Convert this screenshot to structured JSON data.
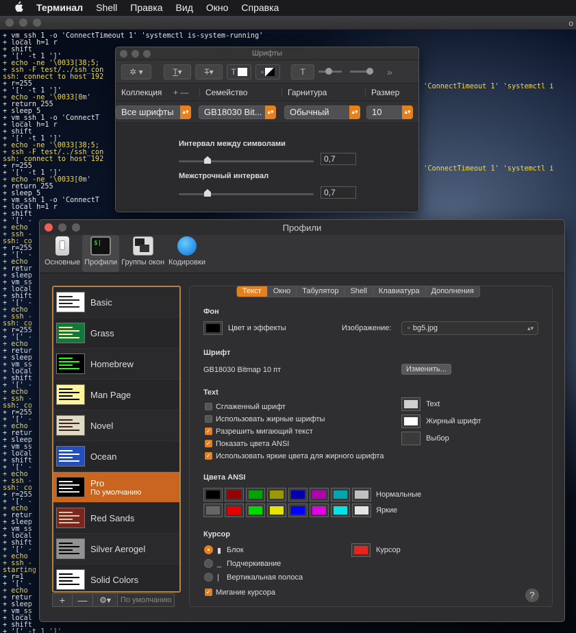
{
  "menubar": {
    "apple": "",
    "app": "Терминал",
    "items": [
      "Shell",
      "Правка",
      "Вид",
      "Окно",
      "Справка"
    ]
  },
  "terminal": {
    "title_fragment": "o",
    "lines": [
      "+ vm_ssh 1 -o 'ConnectTimeout 1' 'systemctl is-system-running'",
      "+ local h=1 r",
      "+ shift",
      "+ '[' -t 1 ']'",
      "+ echo -ne '\\0033[38;5;",
      "+ ssh -F test/../ssh_con",
      "ssh: connect to host 192",
      "+ r=255",
      "+ '[' -t 1 ']'",
      "+ echo -ne '\\0033[0m'",
      "+ return 255",
      "+ sleep 5",
      "+ vm_ssh 1 -o 'ConnectT",
      "+ local h=1 r",
      "+ shift",
      "+ '[' -t 1 ']'",
      "+ echo -ne '\\0033[38;5;",
      "+ ssh -F test/../ssh_con",
      "ssh: connect to host 192",
      "+ r=255",
      "+ '[' -t 1 ']'",
      "+ echo -ne '\\0033[0m'",
      "+ return 255",
      "+ sleep 5",
      "+ vm_ssh 1 -o 'ConnectT",
      "+ local h=1 r",
      "+ shift",
      "+ '[' -",
      "+ echo",
      "+ ssh -",
      "ssh: co",
      "+ r=255",
      "+ '[' -",
      "+ echo",
      "+ retur",
      "+ sleep",
      "+ vm_ss",
      "+ local",
      "+ shift",
      "+ '[' -",
      "+ echo",
      "+ ssh -",
      "ssh: co",
      "+ r=255",
      "+ '[' -",
      "+ echo",
      "+ retur",
      "+ sleep",
      "+ vm_ss",
      "+ local",
      "+ shift",
      "+ '[' -",
      "+ echo",
      "+ ssh -",
      "ssh: co",
      "+ r=255",
      "+ '[' -",
      "+ echo",
      "+ retur",
      "+ sleep",
      "+ vm_ss",
      "+ local",
      "+ shift",
      "+ '[' -",
      "+ echo",
      "+ ssh -",
      "ssh: co",
      "+ r=255",
      "+ '[' -",
      "+ echo",
      "+ retur",
      "+ sleep",
      "+ vm_ss",
      "+ local",
      "+ shift",
      "+ '[' -",
      "+ echo",
      "+ ssh -",
      "starting",
      "+ r=1",
      "+ '[' -",
      "+ echo",
      "+ retur",
      "+ sleep",
      "+ vm_ss",
      "+ local",
      "+ shift",
      "+ '[' -t 1 ']'"
    ],
    "right_1": "o 'ConnectTimeout 1' 'systemctl i",
    "right_2": "o 'ConnectTimeout 1' 'systemctl i"
  },
  "fonts_panel": {
    "title": "Шрифты",
    "col_collection": "Коллекция",
    "col_family": "Семейство",
    "col_typeface": "Гарнитура",
    "col_size": "Размер",
    "add": "+",
    "remove": "—",
    "collection": "Все шрифты",
    "family": "GB18030 Bit...",
    "typeface": "Обычный",
    "size": "10",
    "char_spacing_label": "Интервал между символами",
    "char_spacing_value": "0,7",
    "line_spacing_label": "Межстрочный интервал",
    "line_spacing_value": "0,7",
    "more": "»"
  },
  "profiles_window": {
    "title": "Профили",
    "toolbar": [
      "Основные",
      "Профили",
      "Группы окон",
      "Кодировки"
    ],
    "profiles": [
      {
        "name": "Basic",
        "bg": "#ffffff",
        "fg": "#222222"
      },
      {
        "name": "Grass",
        "bg": "#13773d",
        "fg": "#fff0a5"
      },
      {
        "name": "Homebrew",
        "bg": "#000000",
        "fg": "#28fe14"
      },
      {
        "name": "Man Page",
        "bg": "#fef49c",
        "fg": "#000000"
      },
      {
        "name": "Novel",
        "bg": "#dfdbc3",
        "fg": "#3b2322"
      },
      {
        "name": "Ocean",
        "bg": "#224fbc",
        "fg": "#ffffff"
      },
      {
        "name": "Pro",
        "sub": "По умолчанию",
        "bg": "#000000",
        "fg": "#f2f2f2"
      },
      {
        "name": "Red Sands",
        "bg": "#7a251e",
        "fg": "#d7c9a7"
      },
      {
        "name": "Silver Aerogel",
        "bg": "#929292",
        "fg": "#000000"
      },
      {
        "name": "Solid Colors",
        "bg": "#ffffff",
        "fg": "#000000"
      }
    ],
    "add": "+",
    "remove": "—",
    "gear": "⚙︎",
    "default_btn": "По умолчанию",
    "tabs": [
      "Текст",
      "Окно",
      "Табулятор",
      "Shell",
      "Клавиатура",
      "Дополнения"
    ],
    "bg_section": "Фон",
    "color_effects": "Цвет и эффекты",
    "image_label": "Изображение:",
    "image_value": "bg5.jpg",
    "font_section": "Шрифт",
    "font_value": "GB18030 Bitmap 10 пт",
    "change_btn": "Изменить...",
    "text_section": "Text",
    "checks": [
      {
        "label": "Сглаженный шрифт",
        "on": false
      },
      {
        "label": "Использовать жирные шрифты",
        "on": false
      },
      {
        "label": "Разрешить мигающий текст",
        "on": true
      },
      {
        "label": "Показать цвета ANSI",
        "on": true
      },
      {
        "label": "Использовать яркие цвета для жирного шрифта",
        "on": true
      }
    ],
    "wells": [
      {
        "label": "Text",
        "color": "#d0d0d0"
      },
      {
        "label": "Жирный шрифт",
        "color": "#ffffff"
      },
      {
        "label": "Выбор",
        "color": "#3a3a3a"
      }
    ],
    "bg_color": "#000000",
    "ansi_section": "Цвета ANSI",
    "ansi_normal_label": "Нормальные",
    "ansi_bright_label": "Яркие",
    "ansi_normal": [
      "#000000",
      "#990000",
      "#00a600",
      "#999900",
      "#0000b2",
      "#b200b2",
      "#00a6b2",
      "#bfbfbf"
    ],
    "ansi_bright": [
      "#666666",
      "#e50000",
      "#00d900",
      "#e5e500",
      "#0000ff",
      "#e500e5",
      "#00e5e5",
      "#e5e5e5"
    ],
    "cursor_section": "Курсор",
    "cursor_options": [
      {
        "label": "Блок",
        "glyph": "▮",
        "on": true
      },
      {
        "label": "Подчеркивание",
        "glyph": "_",
        "on": false
      },
      {
        "label": "Вертикальная полоса",
        "glyph": "|",
        "on": false
      }
    ],
    "cursor_color_label": "Курсор",
    "cursor_color": "#e8241c",
    "blink_label": "Мигание курсора",
    "help": "?"
  }
}
